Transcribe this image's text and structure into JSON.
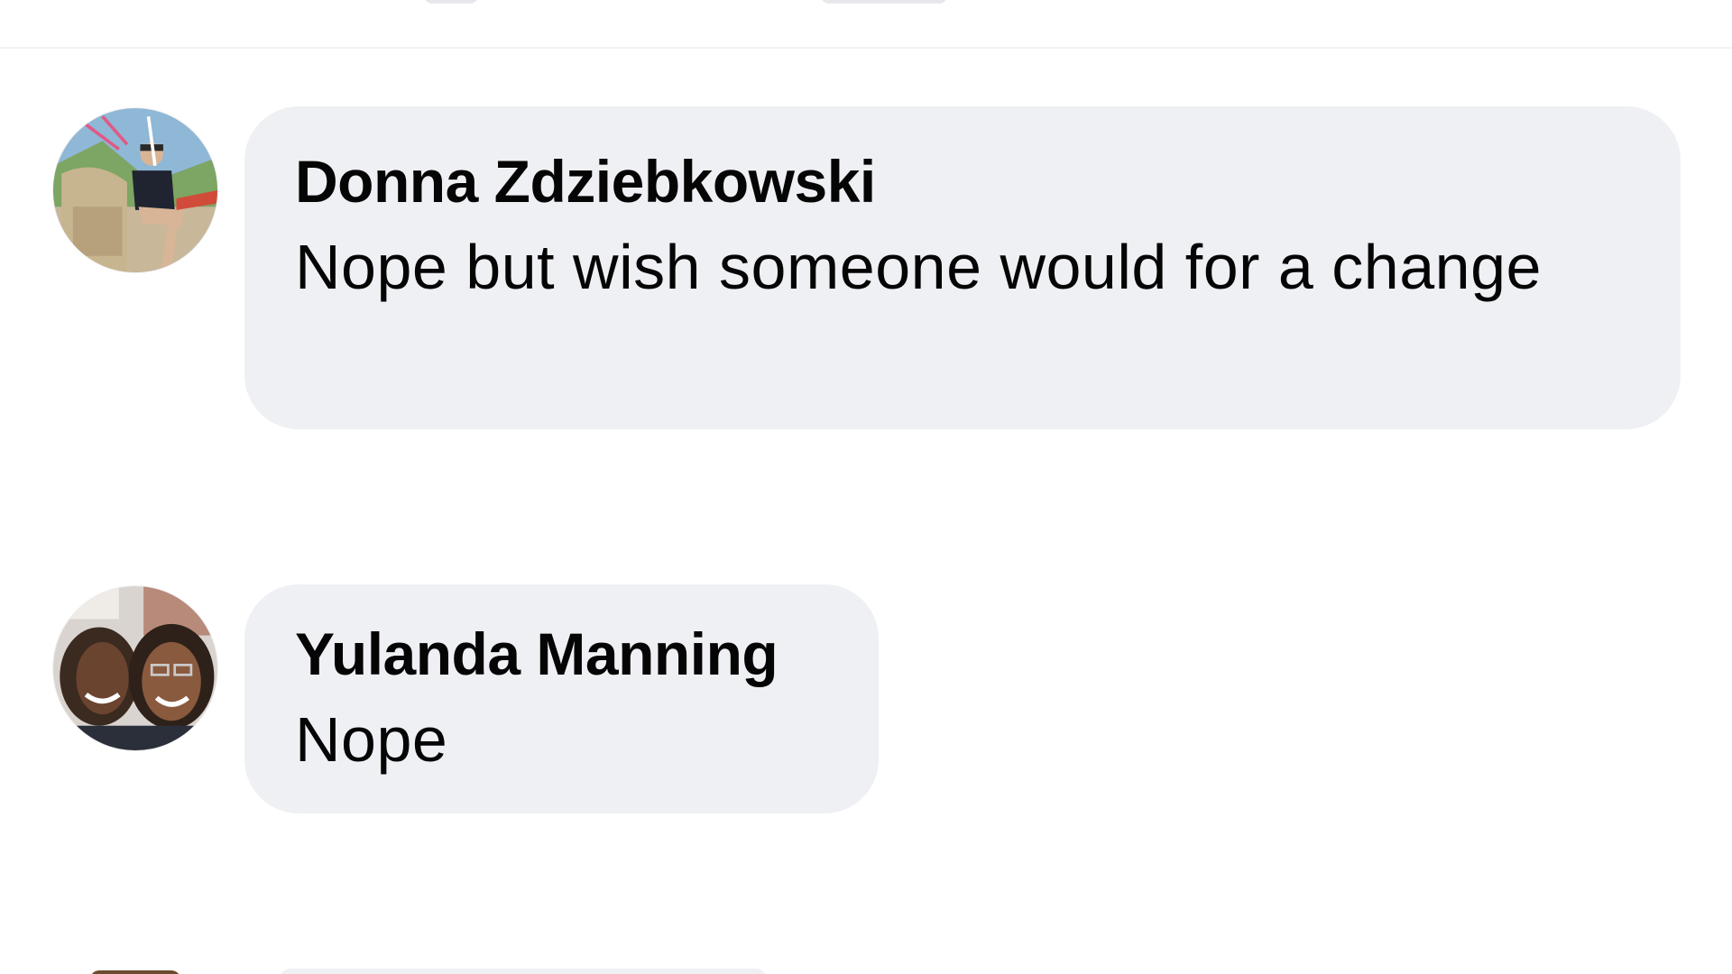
{
  "comments": [
    {
      "author": "Donna Zdziebkowski",
      "text": "Nope but wish someone would for a change",
      "avatar_icon": "user-avatar-photo"
    },
    {
      "author": "Yulanda Manning",
      "text": "Nope",
      "avatar_icon": "user-avatar-photo"
    }
  ],
  "colors": {
    "bubble": "#eff0f4",
    "text": "#050505",
    "background": "#ffffff"
  }
}
